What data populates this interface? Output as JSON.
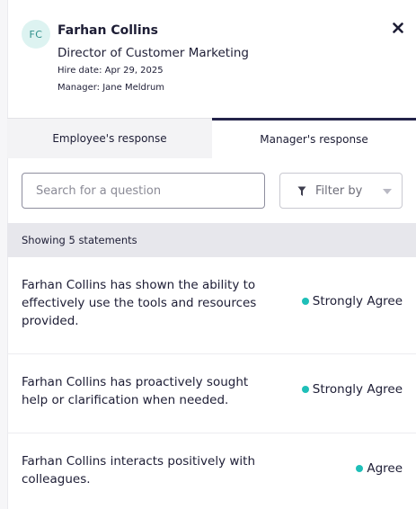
{
  "employee": {
    "initials": "FC",
    "name": "Farhan Collins",
    "title": "Director of Customer Marketing",
    "hire_date": "Hire date: Apr 29, 2025",
    "manager": "Manager: Jane Meldrum"
  },
  "tabs": [
    {
      "label": "Employee's response",
      "active": false
    },
    {
      "label": "Manager's response",
      "active": true
    }
  ],
  "search": {
    "placeholder": "Search for a question",
    "value": ""
  },
  "filter": {
    "label": "Filter by"
  },
  "count_label": "Showing 5 statements",
  "statements": [
    {
      "text": "Farhan Collins has shown the ability to effectively use the tools and resources provided.",
      "answer": "Strongly Agree"
    },
    {
      "text": "Farhan Collins has proactively sought help or clarification when needed.",
      "answer": "Strongly Agree"
    },
    {
      "text": "Farhan Collins interacts positively with colleagues.",
      "answer": "Agree"
    }
  ],
  "colors": {
    "accent": "#23234a",
    "answer_dot": "#1fbfb8",
    "avatar_bg": "#ddf3f1"
  },
  "icons": {
    "close": "close-icon",
    "filter": "filter-icon",
    "caret": "chevron-down-icon"
  }
}
